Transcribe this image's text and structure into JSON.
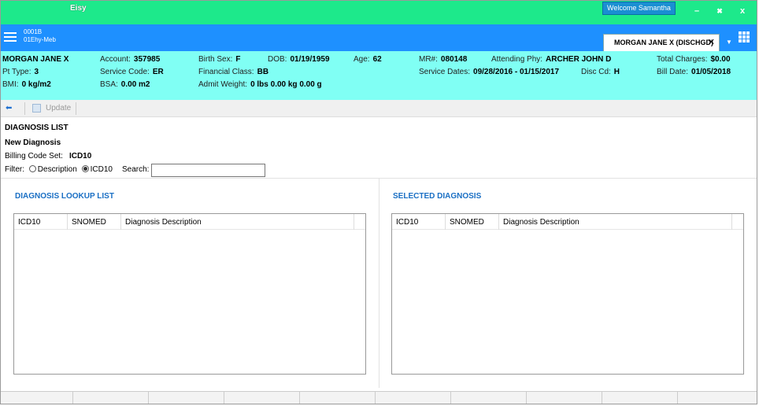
{
  "titlebar": {
    "app_title": "Eisy",
    "welcome": "Welcome Samantha",
    "minimize_glyph": "–",
    "restore_glyph": "✖",
    "close_glyph": "x"
  },
  "header": {
    "facility_line1": "0001B",
    "facility_line2": "01Ehy-Meb",
    "patient_tab": "MORGAN JANE X (DISCHGD)",
    "tab_close": "✕",
    "tab_dropdown": "▼"
  },
  "patient": {
    "name": "MORGAN JANE X",
    "pt_type_label": "Pt Type:",
    "pt_type": "3",
    "bmi_label": "BMI:",
    "bmi": "0 kg/m2",
    "account_label": "Account:",
    "account": "357985",
    "service_code_label": "Service Code:",
    "service_code": "ER",
    "bsa_label": "BSA:",
    "bsa": "0.00 m2",
    "birth_sex_label": "Birth Sex:",
    "birth_sex": "F",
    "financial_class_label": "Financial Class:",
    "financial_class": "BB",
    "admit_weight_label": "Admit Weight:",
    "admit_weight": "0 lbs 0.00 kg 0.00 g",
    "dob_label": "DOB:",
    "dob": "01/19/1959",
    "age_label": "Age:",
    "age": "62",
    "mr_label": "MR#:",
    "mr": "080148",
    "service_dates_label": "Service Dates:",
    "service_dates": "09/28/2016 - 01/15/2017",
    "attending_label": "Attending Phy:",
    "attending": "ARCHER JOHN D",
    "disc_cd_label": "Disc Cd:",
    "disc_cd": "H",
    "total_charges_label": "Total Charges:",
    "total_charges": "$0.00",
    "bill_date_label": "Bill Date:",
    "bill_date": "01/05/2018"
  },
  "toolbar": {
    "back_glyph": "⬅",
    "update_label": "Update"
  },
  "main": {
    "section_title": "DIAGNOSIS LIST",
    "new_diagnosis": "New Diagnosis",
    "billing_code_set_label": "Billing Code Set:",
    "billing_code_set": "ICD10",
    "filter_label": "Filter:",
    "filter_options": [
      "Description",
      "ICD10"
    ],
    "filter_selected": "ICD10",
    "search_label": "Search:",
    "search_value": "",
    "lookup_title": "DIAGNOSIS LOOKUP LIST",
    "selected_title": "SELECTED DIAGNOSIS",
    "columns": [
      "ICD10",
      "SNOMED",
      "Diagnosis Description"
    ]
  }
}
